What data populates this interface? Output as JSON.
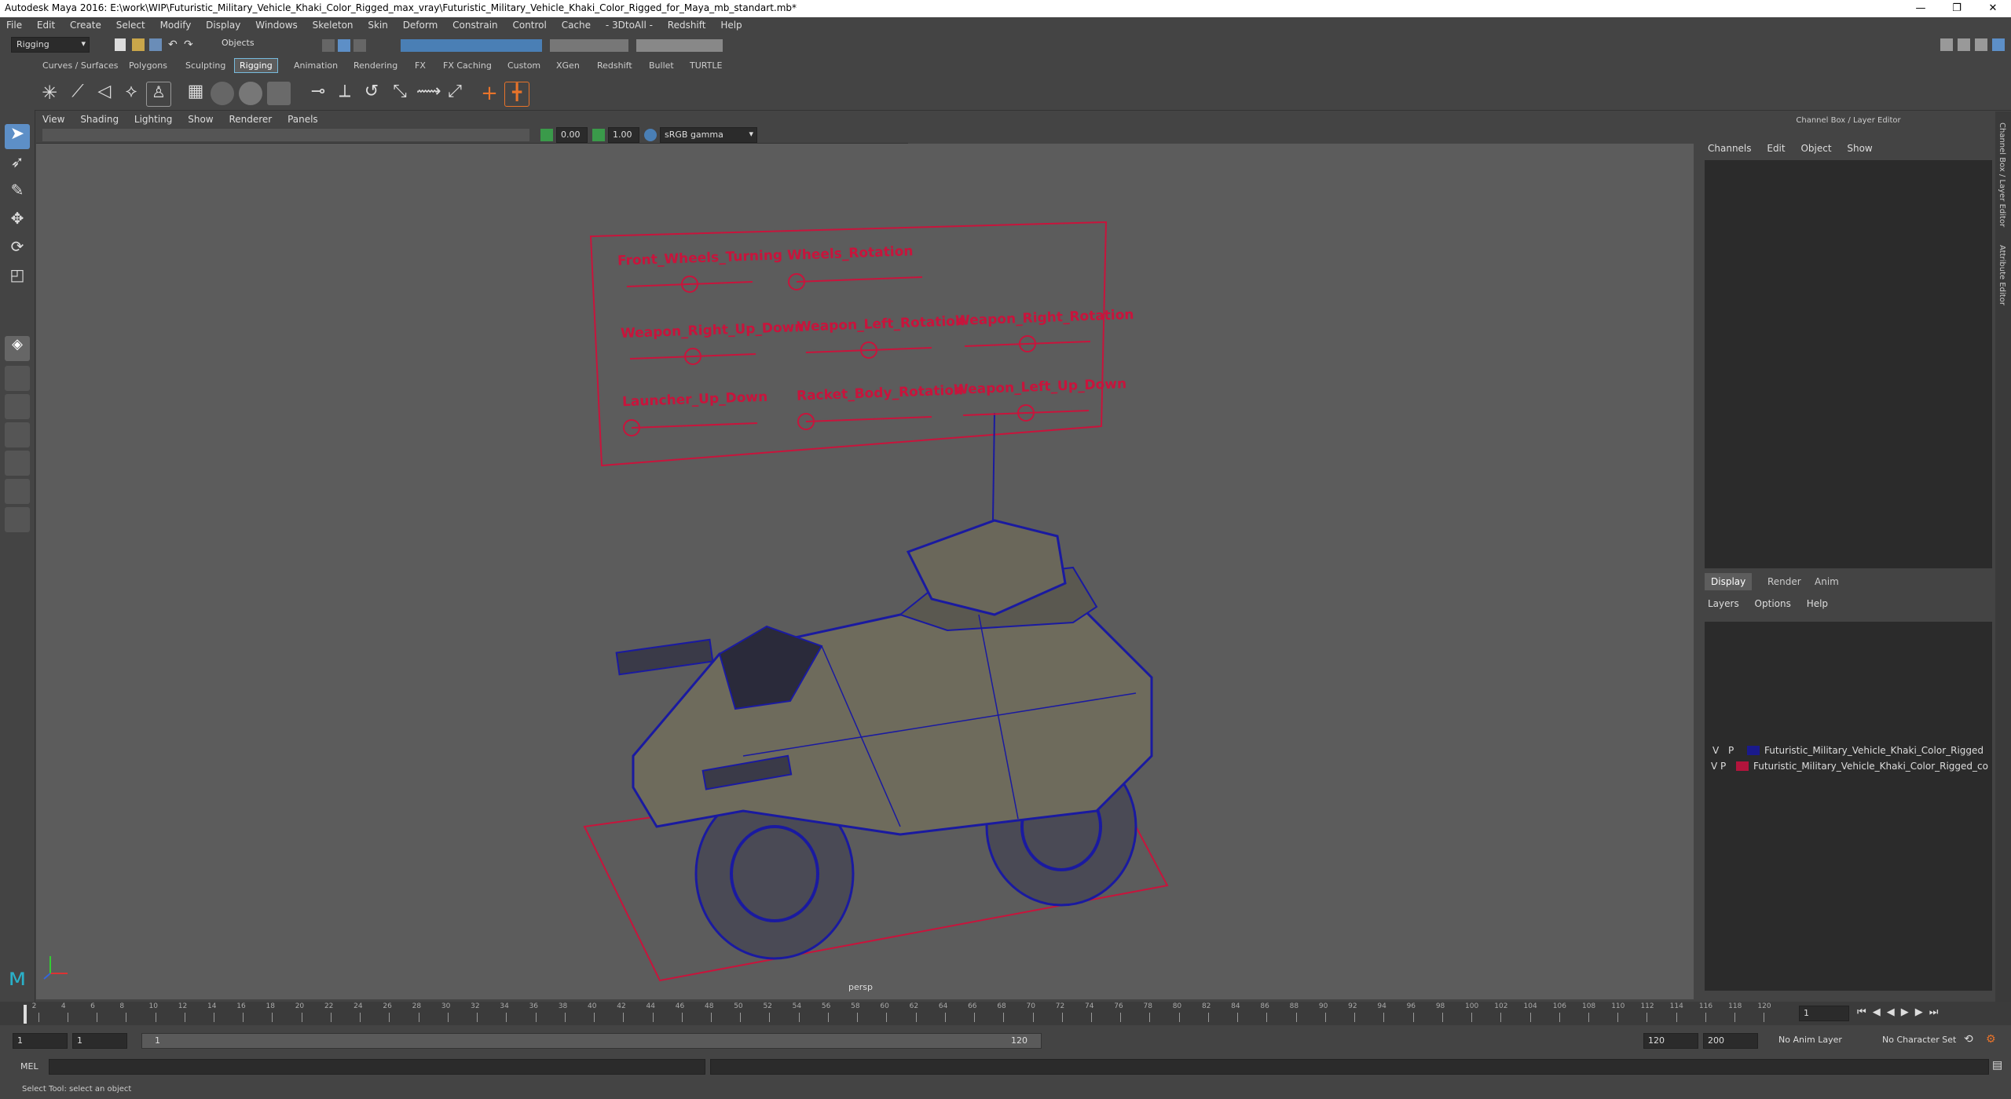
{
  "window": {
    "title": "Autodesk Maya 2016: E:\\work\\WIP\\Futuristic_Military_Vehicle_Khaki_Color_Rigged_max_vray\\Futuristic_Military_Vehicle_Khaki_Color_Rigged_for_Maya_mb_standart.mb*",
    "minimize": "—",
    "restore": "❐",
    "close": "✕"
  },
  "menubar": [
    "File",
    "Edit",
    "Create",
    "Select",
    "Modify",
    "Display",
    "Windows",
    "Skeleton",
    "Skin",
    "Deform",
    "Constrain",
    "Control",
    "Cache",
    "- 3DtoAll -",
    "Redshift",
    "Help"
  ],
  "status_line": {
    "menu_set": "Rigging",
    "selection_mode": "Objects"
  },
  "shelf_tabs": [
    "Curves / Surfaces",
    "Polygons",
    "Sculpting",
    "Rigging",
    "Animation",
    "Rendering",
    "FX",
    "FX Caching",
    "Custom",
    "XGen",
    "Redshift",
    "Bullet",
    "TURTLE"
  ],
  "shelf_active": "Rigging",
  "panel_menu": [
    "View",
    "Shading",
    "Lighting",
    "Show",
    "Renderer",
    "Panels"
  ],
  "panel_toolbar": {
    "exposure": "0.00",
    "gamma": "1.00",
    "color_space": "sRGB gamma"
  },
  "viewport": {
    "camera_label": "persp",
    "control_board": {
      "labels": [
        "Front_Wheels_Turning",
        "Wheels_Rotation",
        "Weapon_Right_Up_Down",
        "Weapon_Left_Rotation",
        "Weapon_Right_Rotation",
        "Launcher_Up_Down",
        "Racket_Body_Rotation",
        "Weapon_Left_Up_Down"
      ],
      "slider_values": [
        0.5,
        0.0,
        0.5,
        0.5,
        0.5,
        0.0,
        0.0,
        0.5
      ]
    }
  },
  "channel_box": {
    "title": "Channel Box / Layer Editor",
    "menu": [
      "Channels",
      "Edit",
      "Object",
      "Show"
    ]
  },
  "layer_editor": {
    "tabs": [
      "Display",
      "Render",
      "Anim"
    ],
    "active_tab": "Display",
    "menu": [
      "Layers",
      "Options",
      "Help"
    ],
    "layers": [
      {
        "visible": "V",
        "playback": "P",
        "color": "#1a1a8c",
        "name": "Futuristic_Military_Vehicle_Khaki_Color_Rigged"
      },
      {
        "visible": "V",
        "playback": "P",
        "color": "#b3143c",
        "name": "Futuristic_Military_Vehicle_Khaki_Color_Rigged_controllers"
      }
    ]
  },
  "side_tabs": [
    "Channel Box / Layer Editor",
    "Attribute Editor"
  ],
  "time_slider": {
    "ticks": [
      "2",
      "4",
      "6",
      "8",
      "10",
      "12",
      "14",
      "16",
      "18",
      "20",
      "22",
      "24",
      "26",
      "28",
      "30",
      "32",
      "34",
      "36",
      "38",
      "40",
      "42",
      "44",
      "46",
      "48",
      "50",
      "52",
      "54",
      "56",
      "58",
      "60",
      "62",
      "64",
      "66",
      "68",
      "70",
      "72",
      "74",
      "76",
      "78",
      "80",
      "82",
      "84",
      "86",
      "88",
      "90",
      "92",
      "94",
      "96",
      "98",
      "100",
      "102",
      "104",
      "106",
      "108",
      "110",
      "112",
      "114",
      "116",
      "118",
      "120"
    ],
    "current_frame": "1"
  },
  "range_slider": {
    "start": "1",
    "playback_start": "1",
    "range_start_label": "1",
    "range_end_label": "120",
    "playback_end": "120",
    "end": "200",
    "anim_layer": "No Anim Layer",
    "character_set": "No Character Set"
  },
  "command_line": {
    "language": "MEL"
  },
  "help_line": {
    "text": "Select Tool: select an object"
  },
  "colors": {
    "controller": "#c8143c",
    "wireframe": "#1a1aa0",
    "viewport_bg": "#5c5c5c"
  }
}
